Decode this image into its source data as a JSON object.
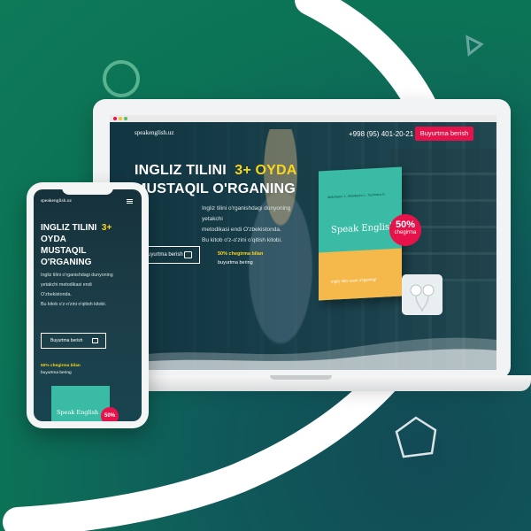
{
  "colors": {
    "accent": "#e8124a",
    "highlight": "#f9d51c",
    "book_teal": "#39bba5",
    "book_orange": "#f5b84a",
    "bg_green": "#0d6b52"
  },
  "desktop": {
    "logo": "speakenglish.uz",
    "phone": "+998 (95) 401-20-21",
    "cta": "Buyurtma berish",
    "headline_line1": "INGLIZ TILINI",
    "headline_highlight": "3+ OYDA",
    "headline_line2": "MUSTAQIL O'RGANING",
    "description": [
      "Ingliz tilini o'rganishdagi dunyoning yetakchi",
      "metodikasi endi O'zbekistonda.",
      "Bu kitob o'z-o'zini o'qitish kitobi."
    ],
    "order_button": "Buyurtma berish",
    "discount_highlight": "50% chegirma bilan",
    "discount_rest": "buyurtma bering"
  },
  "book": {
    "authors": "Abdullayev J., Abdullayev L., Tashtekov D.",
    "title": "Speak English",
    "slogan": "Ingliz tilini oson o'rganing!",
    "badge_pct": "50%",
    "badge_label": "chegirma"
  },
  "mobile": {
    "logo": "speakenglish.uz",
    "headline_line1": "INGLIZ TILINI",
    "headline_highlight_a": "3+",
    "headline_highlight_b": "OYDA",
    "headline_line3": "MUSTAQIL",
    "headline_line4": "O'RGANING",
    "description": [
      "Ingliz tilini o'rganishdagi dunyoning",
      "yetakchi metodikasi endi",
      "O'zbekistonda.",
      "Bu kitob o'z-o'zini o'qitish kitobi."
    ],
    "order_button": "Buyurtma berish",
    "discount_line1": "50% chegirma bilan",
    "discount_line2": "buyurtma bering",
    "book_title": "Speak English",
    "badge": "50%"
  },
  "icons": {
    "ring": "circle-outline-icon",
    "triangle": "triangle-outline-icon",
    "hexagon": "hexagon-outline-icon",
    "menu": "hamburger-menu-icon",
    "cart": "basket-icon"
  }
}
